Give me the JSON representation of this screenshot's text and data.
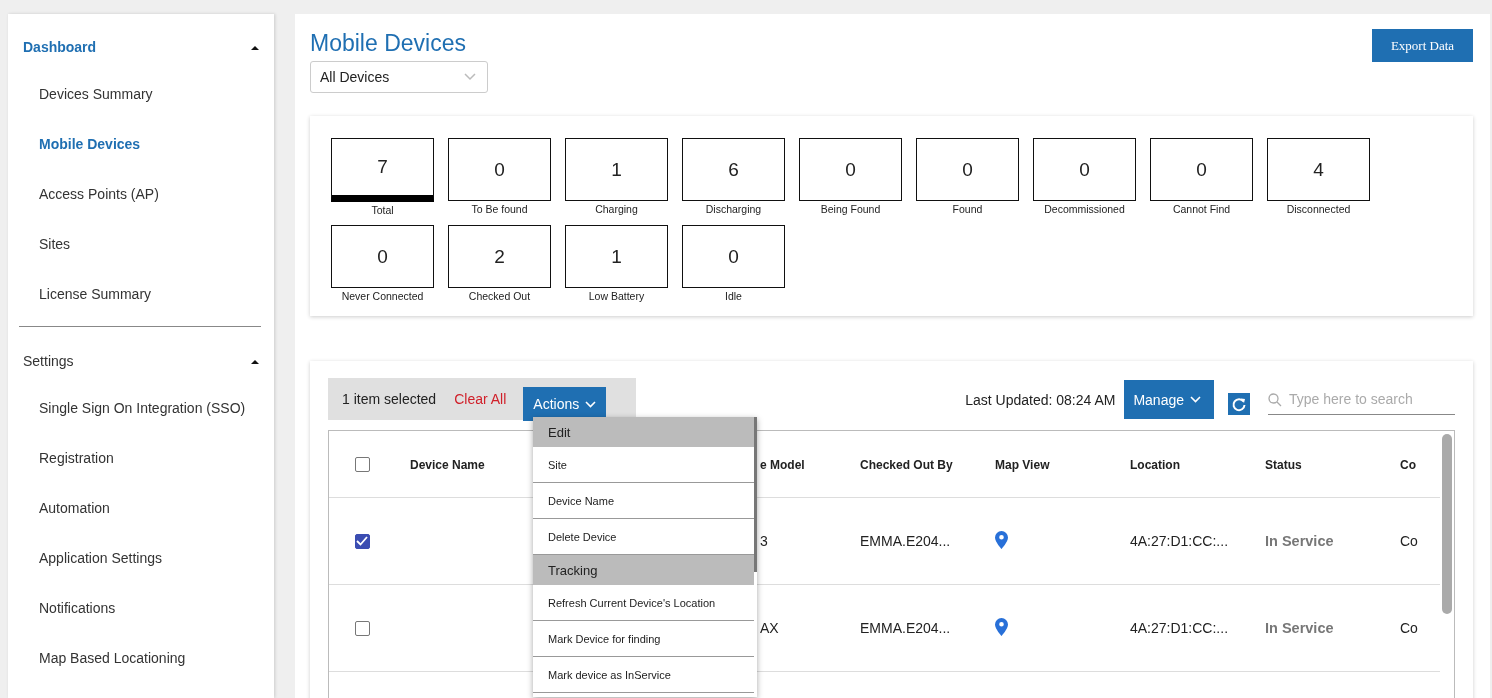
{
  "sidebar": {
    "sections": [
      {
        "title": "Dashboard",
        "expanded": true,
        "items": [
          {
            "label": "Devices Summary",
            "selected": false
          },
          {
            "label": "Mobile Devices",
            "selected": true
          },
          {
            "label": "Access Points (AP)",
            "selected": false
          },
          {
            "label": "Sites",
            "selected": false
          },
          {
            "label": "License Summary",
            "selected": false
          }
        ]
      },
      {
        "title": "Settings",
        "expanded": true,
        "items": [
          {
            "label": "Single Sign On Integration (SSO)",
            "selected": false
          },
          {
            "label": "Registration",
            "selected": false
          },
          {
            "label": "Automation",
            "selected": false
          },
          {
            "label": "Application Settings",
            "selected": false
          },
          {
            "label": "Notifications",
            "selected": false
          },
          {
            "label": "Map Based Locationing",
            "selected": false
          }
        ]
      }
    ]
  },
  "page": {
    "title": "Mobile Devices",
    "filter": "All Devices",
    "export_button": "Export Data"
  },
  "stats": [
    {
      "value": "7",
      "label": "Total",
      "selected": true
    },
    {
      "value": "0",
      "label": "To Be found",
      "selected": false
    },
    {
      "value": "1",
      "label": "Charging",
      "selected": false
    },
    {
      "value": "6",
      "label": "Discharging",
      "selected": false
    },
    {
      "value": "0",
      "label": "Being Found",
      "selected": false
    },
    {
      "value": "0",
      "label": "Found",
      "selected": false
    },
    {
      "value": "0",
      "label": "Decommissioned",
      "selected": false
    },
    {
      "value": "0",
      "label": "Cannot Find",
      "selected": false
    },
    {
      "value": "4",
      "label": "Disconnected",
      "selected": false
    },
    {
      "value": "0",
      "label": "Never Connected",
      "selected": false
    },
    {
      "value": "2",
      "label": "Checked Out",
      "selected": false
    },
    {
      "value": "1",
      "label": "Low Battery",
      "selected": false
    },
    {
      "value": "0",
      "label": "Idle",
      "selected": false
    }
  ],
  "toolbar": {
    "selection_text": "1 item selected",
    "clear_button": "Clear All",
    "actions_button": "Actions",
    "last_updated": "Last Updated: 08:24 AM",
    "manage_button": "Manage",
    "search_placeholder": "Type here to search"
  },
  "actions_menu": [
    {
      "label": "Edit",
      "kind": "header"
    },
    {
      "label": "Site",
      "kind": "item"
    },
    {
      "label": "Device Name",
      "kind": "item"
    },
    {
      "label": "Delete Device",
      "kind": "item"
    },
    {
      "label": "Tracking",
      "kind": "header"
    },
    {
      "label": "Refresh Current Device's Location",
      "kind": "item"
    },
    {
      "label": "Mark Device for finding",
      "kind": "item"
    },
    {
      "label": "Mark device as InService",
      "kind": "item"
    }
  ],
  "table": {
    "all_checked": false,
    "columns": [
      "Device Name",
      "e Model",
      "Checked Out By",
      "Map View",
      "Location",
      "Status",
      "Co"
    ],
    "rows": [
      {
        "checked": true,
        "device_name": "",
        "model": "3",
        "checked_out_by": "EMMA.E204...",
        "map_view": true,
        "location": "4A:27:D1:CC:...",
        "status": "In Service",
        "column_7": "Co"
      },
      {
        "checked": false,
        "device_name": "",
        "model": "AX",
        "checked_out_by": "EMMA.E204...",
        "map_view": true,
        "location": "4A:27:D1:CC:...",
        "status": "In Service",
        "column_7": "Co"
      }
    ]
  }
}
